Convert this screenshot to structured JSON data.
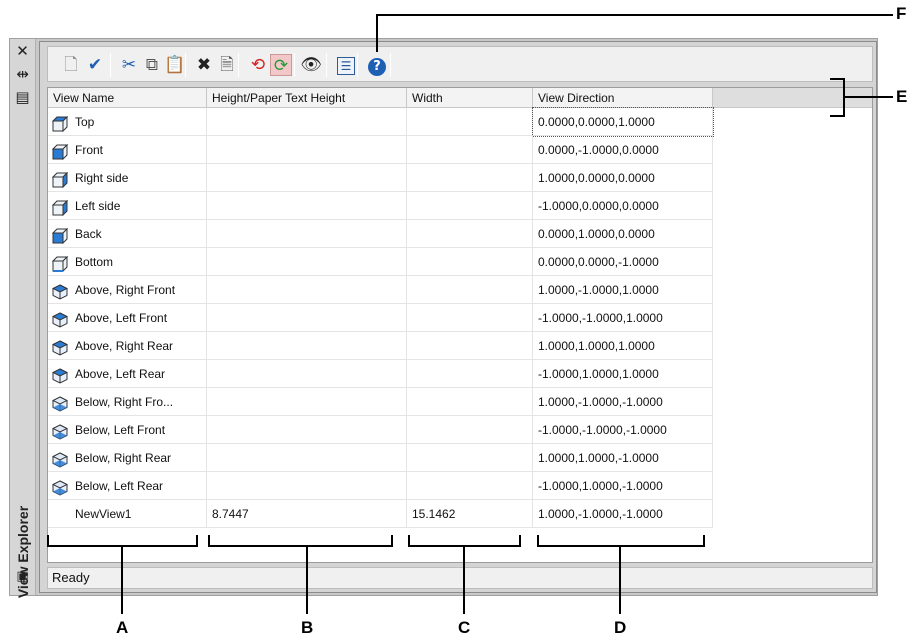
{
  "window": {
    "title": "View Explorer",
    "close_icon": "close-icon",
    "autohide_icon": "autohide-icon",
    "properties_icon": "properties-icon",
    "status_icon": "description-toggle-icon"
  },
  "toolbar": {
    "buttons": [
      {
        "name": "new-view-button",
        "icon": "new-view-icon",
        "glyph": "🗋",
        "color": "#8a8a8a"
      },
      {
        "name": "set-current-button",
        "icon": "checkmark-icon",
        "glyph": "✔",
        "color": "#1f5fb3"
      },
      {
        "name": "cut-button",
        "icon": "scissors-icon",
        "glyph": "✂",
        "color": "#1f5fb3"
      },
      {
        "name": "copy-button",
        "icon": "copy-icon",
        "glyph": "⧉",
        "color": "#555555"
      },
      {
        "name": "paste-button",
        "icon": "paste-icon",
        "glyph": "📋",
        "color": "#777777"
      },
      {
        "name": "delete-button",
        "icon": "delete-x-icon",
        "glyph": "✖",
        "color": "#222222"
      },
      {
        "name": "import-button",
        "icon": "import-icon",
        "glyph": "🗎",
        "color": "#555555"
      },
      {
        "name": "restore-button",
        "icon": "restore-arrows-icon",
        "glyph": "⟲",
        "color": "#d62020"
      },
      {
        "name": "refresh-button",
        "icon": "refresh-arrows-icon",
        "glyph": "⟳",
        "color": "#2a9a3a"
      },
      {
        "name": "show-button",
        "icon": "eye-icon",
        "glyph": "👁",
        "color": "#222222"
      },
      {
        "name": "details-button",
        "icon": "details-list-icon",
        "glyph": "☰",
        "color": "#2b5b9a"
      },
      {
        "name": "help-button",
        "icon": "help-icon",
        "glyph": "?",
        "color": "#ffffff"
      }
    ]
  },
  "table": {
    "columns": [
      "View Name",
      "Height/Paper Text Height",
      "Width",
      "View Direction"
    ],
    "rows": [
      {
        "name": "Top",
        "height": "",
        "width": "",
        "direction": "0.0000,0.0000,1.0000",
        "icon": "cube-top-icon"
      },
      {
        "name": "Front",
        "height": "",
        "width": "",
        "direction": "0.0000,-1.0000,0.0000",
        "icon": "cube-front-icon"
      },
      {
        "name": "Right side",
        "height": "",
        "width": "",
        "direction": "1.0000,0.0000,0.0000",
        "icon": "cube-right-icon"
      },
      {
        "name": "Left side",
        "height": "",
        "width": "",
        "direction": "-1.0000,0.0000,0.0000",
        "icon": "cube-left-icon"
      },
      {
        "name": "Back",
        "height": "",
        "width": "",
        "direction": "0.0000,1.0000,0.0000",
        "icon": "cube-back-icon"
      },
      {
        "name": "Bottom",
        "height": "",
        "width": "",
        "direction": "0.0000,0.0000,-1.0000",
        "icon": "cube-bottom-icon"
      },
      {
        "name": "Above, Right Front",
        "height": "",
        "width": "",
        "direction": "1.0000,-1.0000,1.0000",
        "icon": "iso-above-icon"
      },
      {
        "name": "Above, Left Front",
        "height": "",
        "width": "",
        "direction": "-1.0000,-1.0000,1.0000",
        "icon": "iso-above-icon"
      },
      {
        "name": "Above, Right Rear",
        "height": "",
        "width": "",
        "direction": "1.0000,1.0000,1.0000",
        "icon": "iso-above-icon"
      },
      {
        "name": "Above, Left Rear",
        "height": "",
        "width": "",
        "direction": "-1.0000,1.0000,1.0000",
        "icon": "iso-above-icon"
      },
      {
        "name": "Below, Right Fro...",
        "height": "",
        "width": "",
        "direction": "1.0000,-1.0000,-1.0000",
        "icon": "iso-below-icon"
      },
      {
        "name": "Below, Left Front",
        "height": "",
        "width": "",
        "direction": "-1.0000,-1.0000,-1.0000",
        "icon": "iso-below-icon"
      },
      {
        "name": "Below, Right Rear",
        "height": "",
        "width": "",
        "direction": "1.0000,1.0000,-1.0000",
        "icon": "iso-below-icon"
      },
      {
        "name": "Below, Left Rear",
        "height": "",
        "width": "",
        "direction": "-1.0000,1.0000,-1.0000",
        "icon": "iso-below-icon"
      },
      {
        "name": "NewView1",
        "height": "8.7447",
        "width": "15.1462",
        "direction": "1.0000,-1.0000,-1.0000",
        "icon": ""
      }
    ]
  },
  "status": {
    "text": "Ready"
  },
  "callouts": {
    "a": "A",
    "b": "B",
    "c": "C",
    "d": "D",
    "e": "E",
    "f": "F"
  },
  "colors": {
    "cube_blue": "#2a7bd4",
    "accent_red": "#d62020",
    "accent_green": "#2a9a3a",
    "help_blue": "#1f5fb3"
  }
}
